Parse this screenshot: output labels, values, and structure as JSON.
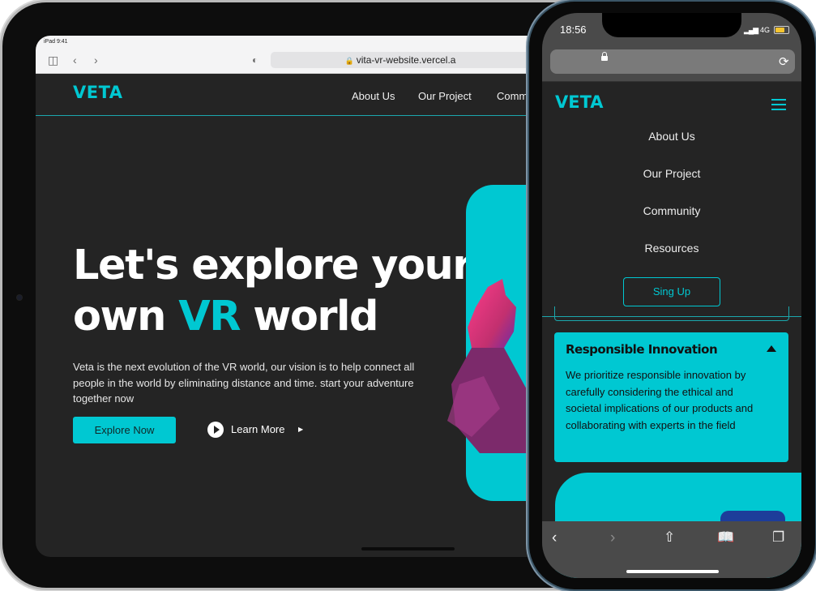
{
  "ipad": {
    "status_time": "iPad 9:41",
    "url": "vita-vr-website.vercel.a",
    "site": {
      "logo": "VETA",
      "nav": [
        "About Us",
        "Our Project",
        "Comm"
      ],
      "hero_title_line1": "Let's explore your",
      "hero_title_line2_pre": "own ",
      "hero_title_accent": "VR",
      "hero_title_line2_post": " world",
      "hero_description": "Veta is the next evolution of the VR world, our vision is to help connect all people in the world by eliminating distance and time. start your adventure together now",
      "explore_button": "Explore Now",
      "learn_more": "Learn More"
    }
  },
  "iphone": {
    "status_time": "18:56",
    "network": "4G",
    "logo": "VETA",
    "menu": [
      "About Us",
      "Our Project",
      "Community",
      "Resources"
    ],
    "signup_button": "Sing Up",
    "accordion": {
      "title": "Responsible Innovation",
      "body": "We prioritize responsible innovation by carefully considering the ethical and societal implications of our products and collaborating with experts in the field"
    }
  },
  "colors": {
    "accent": "#00c8d2",
    "background": "#242424",
    "text": "#ffffff"
  },
  "icons": [
    "sidebar-icon",
    "back-icon",
    "forward-icon",
    "shield-icon",
    "lock-icon",
    "play-icon",
    "caret-right-icon",
    "hamburger-icon",
    "reload-icon",
    "share-icon",
    "bookmarks-icon",
    "tabs-icon",
    "triangle-up-icon"
  ]
}
